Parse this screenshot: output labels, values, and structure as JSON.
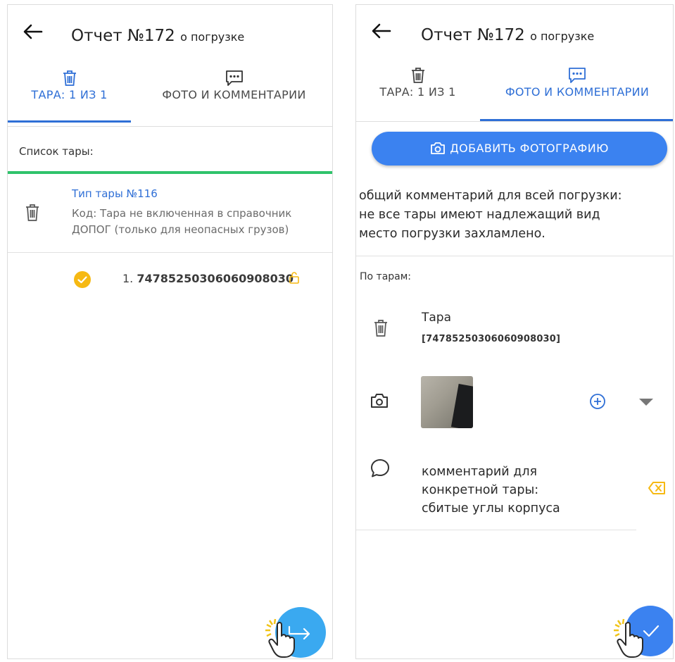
{
  "left": {
    "header": {
      "title": "Отчет №172",
      "subtitle": "о погрузке"
    },
    "tabs": [
      {
        "label": "ТАРА: 1 ИЗ 1",
        "icon": "trash-icon",
        "active": true
      },
      {
        "label": "ФОТО И КОММЕНТАРИИ",
        "icon": "comment-dots-icon",
        "active": false
      }
    ],
    "list_label": "Список тары:",
    "container_type": {
      "name": "Тип тары №116",
      "code_line1": "Код: Тара не включенная в справочник",
      "code_line2": "ДОПОГ (только для неопасных грузов)"
    },
    "item": {
      "index": "1.",
      "number": "74785250306060908030",
      "status": "checked",
      "lock": "unlocked"
    },
    "fab_icon": "export-arrow-icon"
  },
  "right": {
    "header": {
      "title": "Отчет №172",
      "subtitle": "о погрузке"
    },
    "tabs": [
      {
        "label": "ТАРА: 1 ИЗ 1",
        "icon": "trash-icon",
        "active": false
      },
      {
        "label": "ФОТО И КОММЕНТАРИИ",
        "icon": "comment-dots-icon",
        "active": true
      }
    ],
    "add_photo_label": "ДОБАВИТЬ ФОТОГРАФИЮ",
    "general_comment": {
      "line1": "общий комментарий для всей погрузки:",
      "line2": "не все тары имеют надлежащий вид",
      "line3": "место погрузки захламлено."
    },
    "by_container_label": "По тарам:",
    "container": {
      "title": "Тара",
      "number": "[74785250306060908030]"
    },
    "container_comment": {
      "line1": "комментарий для",
      "line2": "конкретной тары:",
      "line3": "сбитые углы корпуса"
    },
    "fab_icon": "check-icon"
  },
  "colors": {
    "accent": "#2f6fd6",
    "button": "#3b82f0",
    "fab_left": "#3aa9f0",
    "green": "#2fc36b",
    "yellow": "#f6b913"
  }
}
